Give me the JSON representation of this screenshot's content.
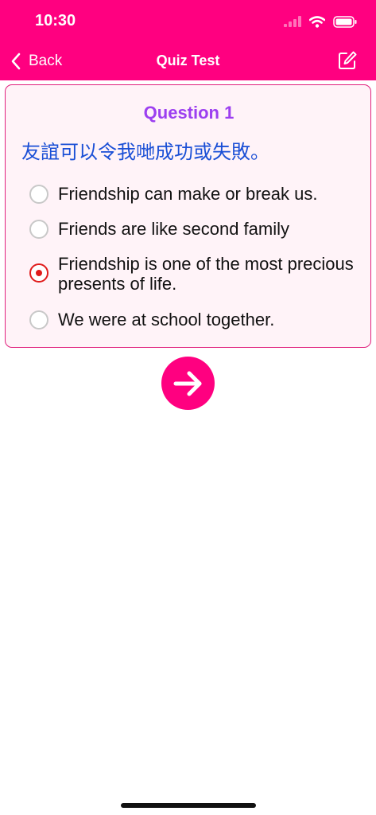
{
  "status_bar": {
    "time": "10:30"
  },
  "nav": {
    "back_label": "Back",
    "title": "Quiz Test"
  },
  "question": {
    "number_label": "Question 1",
    "text": "友誼可以令我哋成功或失敗。",
    "options": [
      {
        "label": "Friendship can make or break us.",
        "selected": false
      },
      {
        "label": "Friends are like second family",
        "selected": false
      },
      {
        "label": "Friendship is one of the most precious presents of life.",
        "selected": true
      },
      {
        "label": "We were at school together.",
        "selected": false
      }
    ]
  },
  "colors": {
    "brand": "#ff0080",
    "question_number": "#9c3ff0",
    "question_text": "#1a4fd6",
    "selected_radio": "#e01b1b"
  }
}
